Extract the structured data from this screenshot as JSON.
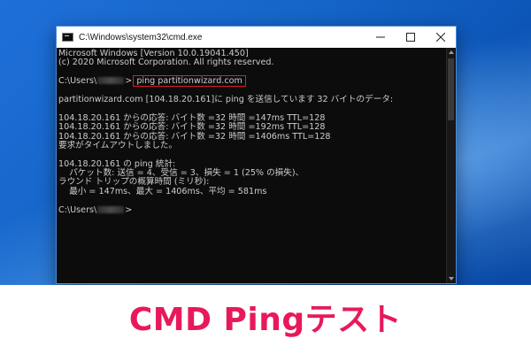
{
  "window": {
    "title": "C:\\Windows\\system32\\cmd.exe",
    "minimize_label": "—",
    "maximize_label": "☐",
    "close_label": "✕"
  },
  "console": {
    "line1": "Microsoft Windows [Version 10.0.19041.450]",
    "line2": "(c) 2020 Microsoft Corporation. All rights reserved.",
    "prompt_prefix": "C:\\Users\\",
    "prompt_suffix": ">",
    "command": "ping partitionwizard.com",
    "line_send": "partitionwizard.com [104.18.20.161]に ping を送信しています 32 バイトのデータ:",
    "reply1": "104.18.20.161 からの応答: バイト数 =32 時間 =147ms TTL=128",
    "reply2": "104.18.20.161 からの応答: バイト数 =32 時間 =192ms TTL=128",
    "reply3": "104.18.20.161 からの応答: バイト数 =32 時間 =1406ms TTL=128",
    "timeout": "要求がタイムアウトしました。",
    "stats_title": "104.18.20.161 の ping 統計:",
    "stats_packets": "    パケット数: 送信 = 4、受信 = 3、損失 = 1 (25% の損失)、",
    "stats_rtt_title": "ラウンド トリップの概算時間 (ミリ秒):",
    "stats_rtt": "    最小 = 147ms、最大 = 1406ms、平均 = 581ms"
  },
  "caption": "CMD Pingテスト",
  "colors": {
    "caption": "#e8195a",
    "highlight_box": "#e01b2b",
    "console_bg": "#0c0c0c",
    "console_text": "#cccccc"
  }
}
